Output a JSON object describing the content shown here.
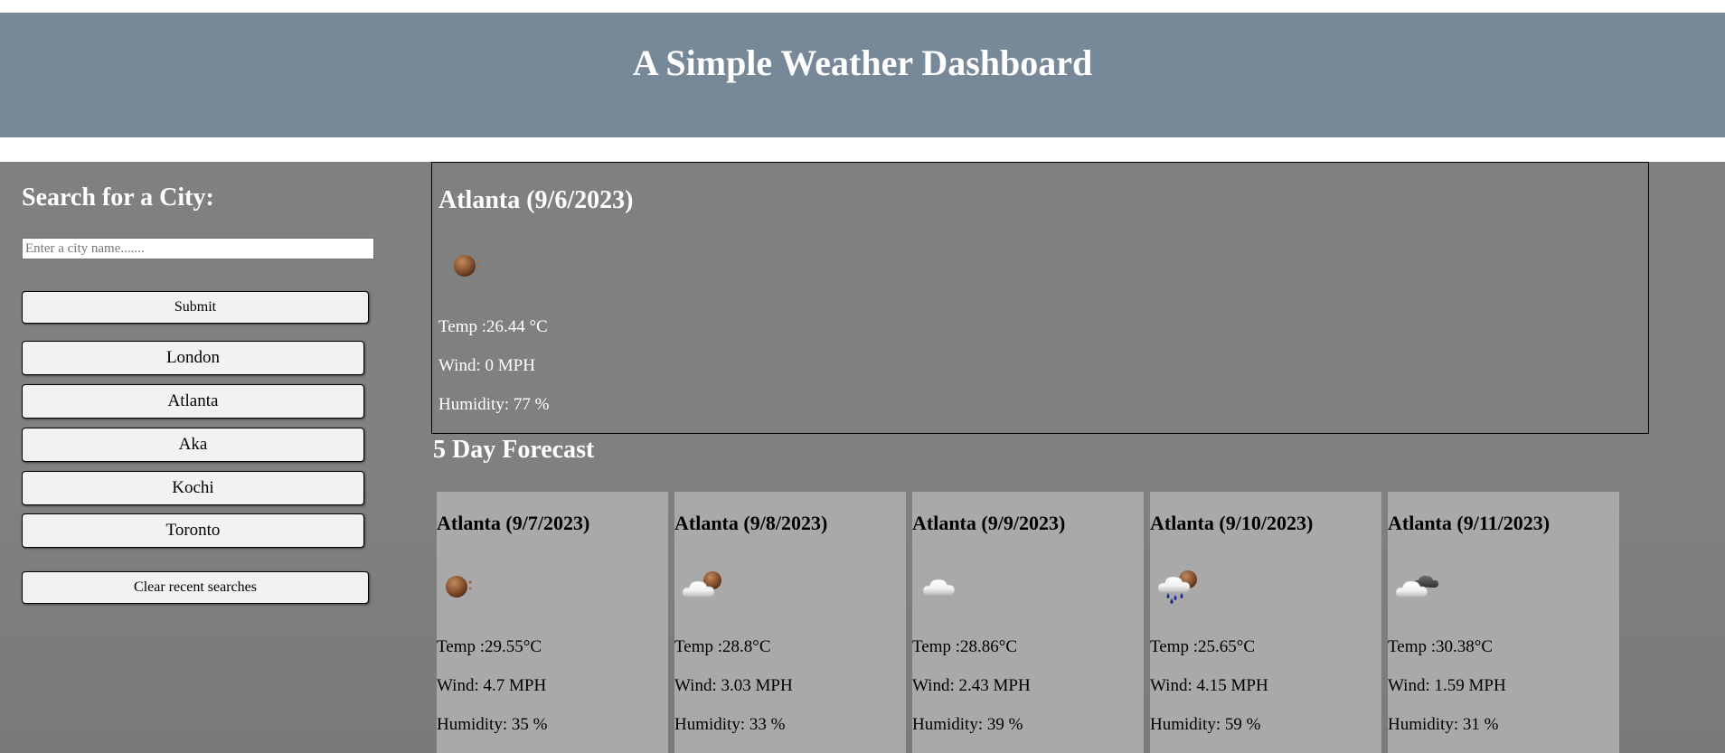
{
  "header": {
    "title": "A Simple Weather Dashboard"
  },
  "search": {
    "heading": "Search for a City:",
    "placeholder": "Enter a city name.......",
    "value": "",
    "submit_label": "Submit",
    "recent": [
      "London",
      "Atlanta",
      "Aka",
      "Kochi",
      "Toronto"
    ],
    "clear_label": "Clear recent searches"
  },
  "current": {
    "title": "Atlanta (9/6/2023)",
    "icon": "clear-night-icon",
    "temp": "Temp :26.44 °C",
    "wind": "Wind: 0 MPH",
    "humidity": "Humidity: 77 %"
  },
  "forecast": {
    "title": "5 Day Forecast",
    "days": [
      {
        "title": "Atlanta (9/7/2023)",
        "icon": "clear-night-icon",
        "temp": "Temp :29.55°C",
        "wind": "Wind: 4.7 MPH",
        "humidity": "Humidity: 35 %"
      },
      {
        "title": "Atlanta (9/8/2023)",
        "icon": "partly-cloudy-night-icon",
        "temp": "Temp :28.8°C",
        "wind": "Wind: 3.03 MPH",
        "humidity": "Humidity: 33 %"
      },
      {
        "title": "Atlanta (9/9/2023)",
        "icon": "cloud-icon",
        "temp": "Temp :28.86°C",
        "wind": "Wind: 2.43 MPH",
        "humidity": "Humidity: 39 %"
      },
      {
        "title": "Atlanta (9/10/2023)",
        "icon": "rain-night-icon",
        "temp": "Temp :25.65°C",
        "wind": "Wind: 4.15 MPH",
        "humidity": "Humidity: 59 %"
      },
      {
        "title": "Atlanta (9/11/2023)",
        "icon": "broken-clouds-icon",
        "temp": "Temp :30.38°C",
        "wind": "Wind: 1.59 MPH",
        "humidity": "Humidity: 31 %"
      }
    ]
  },
  "colors": {
    "header_bg": "#778899",
    "main_bg": "#808080",
    "card_bg": "#a9a9a9"
  }
}
